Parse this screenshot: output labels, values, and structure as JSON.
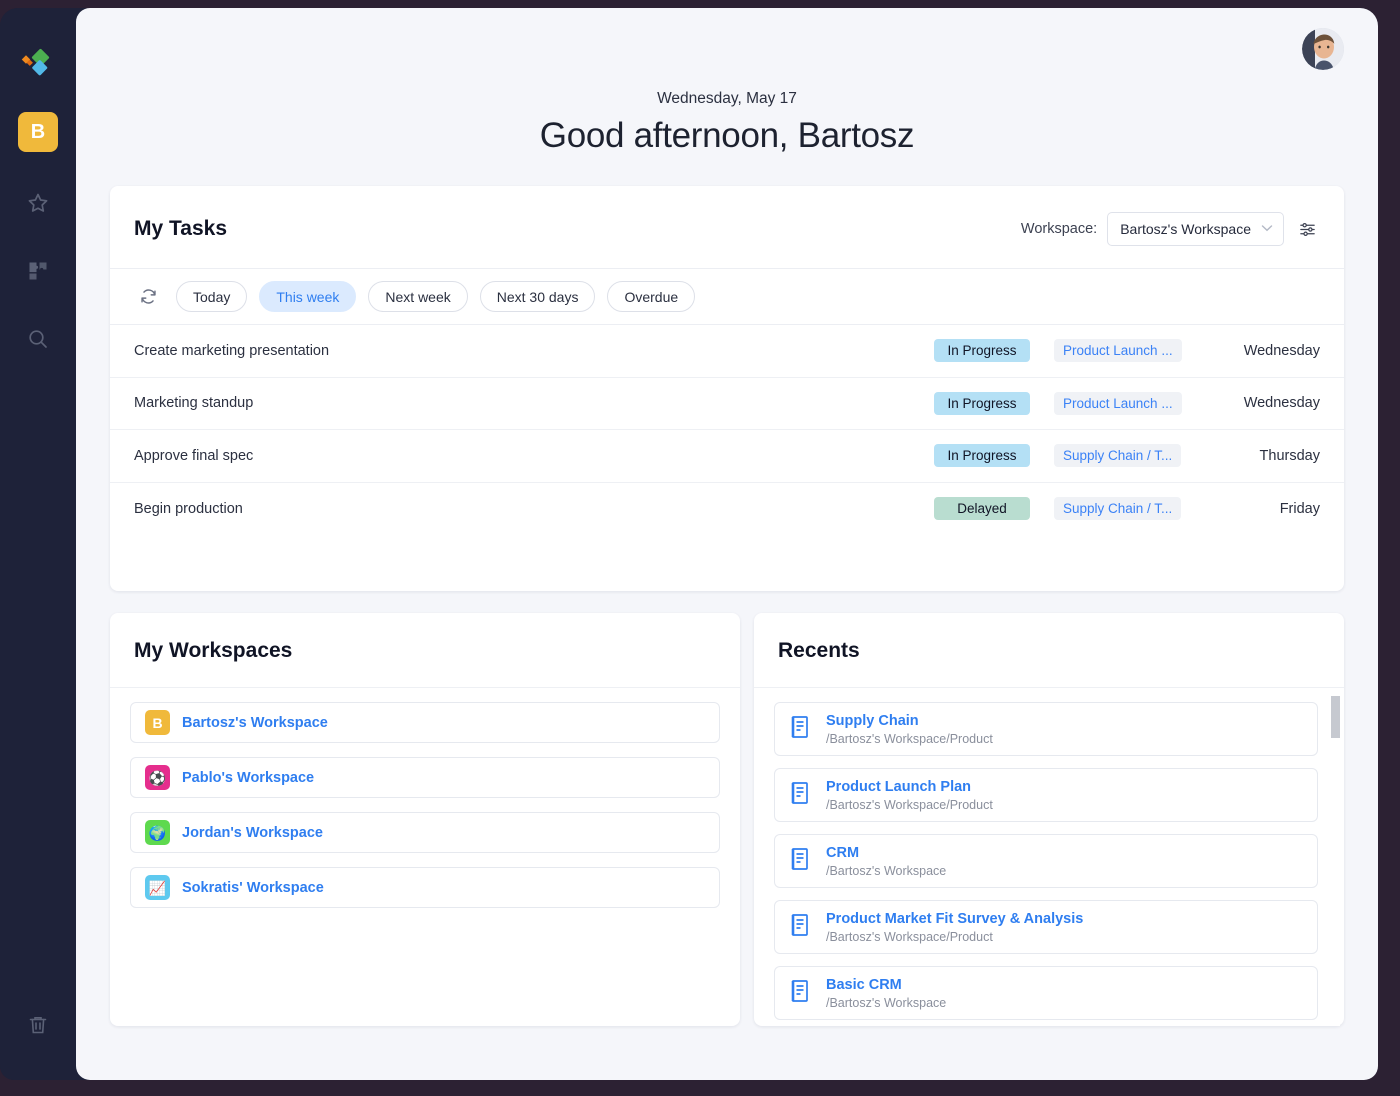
{
  "rail": {
    "logo_name": "app-logo",
    "workspace_initial": "B",
    "items": [
      {
        "name": "favorites",
        "icon": "star-icon"
      },
      {
        "name": "integrations",
        "icon": "puzzle-icon"
      },
      {
        "name": "search",
        "icon": "search-icon"
      },
      {
        "name": "trash",
        "icon": "trash-icon"
      }
    ]
  },
  "header": {
    "date": "Wednesday, May 17",
    "greeting": "Good afternoon, Bartosz",
    "avatar_name": "user-avatar"
  },
  "tasks_card": {
    "title": "My Tasks",
    "workspace_label": "Workspace:",
    "workspace_value": "Bartosz's Workspace",
    "filter_icon": "sliders-icon",
    "refresh_icon": "refresh-icon",
    "chips": [
      {
        "label": "Today",
        "active": false
      },
      {
        "label": "This week",
        "active": true
      },
      {
        "label": "Next week",
        "active": false
      },
      {
        "label": "Next 30 days",
        "active": false
      },
      {
        "label": "Overdue",
        "active": false
      }
    ],
    "rows": [
      {
        "name": "Create marketing presentation",
        "status": "In Progress",
        "status_kind": "inprogress",
        "location": "Product Launch ...",
        "day": "Wednesday"
      },
      {
        "name": "Marketing standup",
        "status": "In Progress",
        "status_kind": "inprogress",
        "location": "Product Launch ...",
        "day": "Wednesday"
      },
      {
        "name": "Approve final spec",
        "status": "In Progress",
        "status_kind": "inprogress",
        "location": "Supply Chain / T...",
        "day": "Thursday"
      },
      {
        "name": "Begin production",
        "status": "Delayed",
        "status_kind": "delayed",
        "location": "Supply Chain / T...",
        "day": "Friday"
      }
    ]
  },
  "workspaces_panel": {
    "title": "My Workspaces",
    "items": [
      {
        "label": "Bartosz's Workspace",
        "glyph": "B",
        "color": "#f0b93b",
        "icon": "letter-b-icon"
      },
      {
        "label": "Pablo's Workspace",
        "glyph": "⚽",
        "color": "#e52e8d",
        "icon": "soccer-ball-icon"
      },
      {
        "label": "Jordan's Workspace",
        "glyph": "🌍",
        "color": "#5ed94e",
        "icon": "globe-icon"
      },
      {
        "label": "Sokratis' Workspace",
        "glyph": "📈",
        "color": "#5ec9ef",
        "icon": "chart-icon"
      }
    ]
  },
  "recents_panel": {
    "title": "Recents",
    "items": [
      {
        "title": "Supply Chain",
        "path": "/Bartosz's Workspace/Product"
      },
      {
        "title": "Product Launch Plan",
        "path": "/Bartosz's Workspace/Product"
      },
      {
        "title": "CRM",
        "path": "/Bartosz's Workspace"
      },
      {
        "title": "Product Market Fit Survey & Analysis",
        "path": "/Bartosz's Workspace/Product"
      },
      {
        "title": "Basic CRM",
        "path": "/Bartosz's Workspace"
      }
    ]
  },
  "colors": {
    "accent_blue": "#2f7ef0",
    "rail_bg": "#1e2239",
    "frame": "#2c2133",
    "chip_active_bg": "#dbeafe",
    "status_inprogress": "#b4e0f5",
    "status_delayed": "#b9ddd0"
  }
}
